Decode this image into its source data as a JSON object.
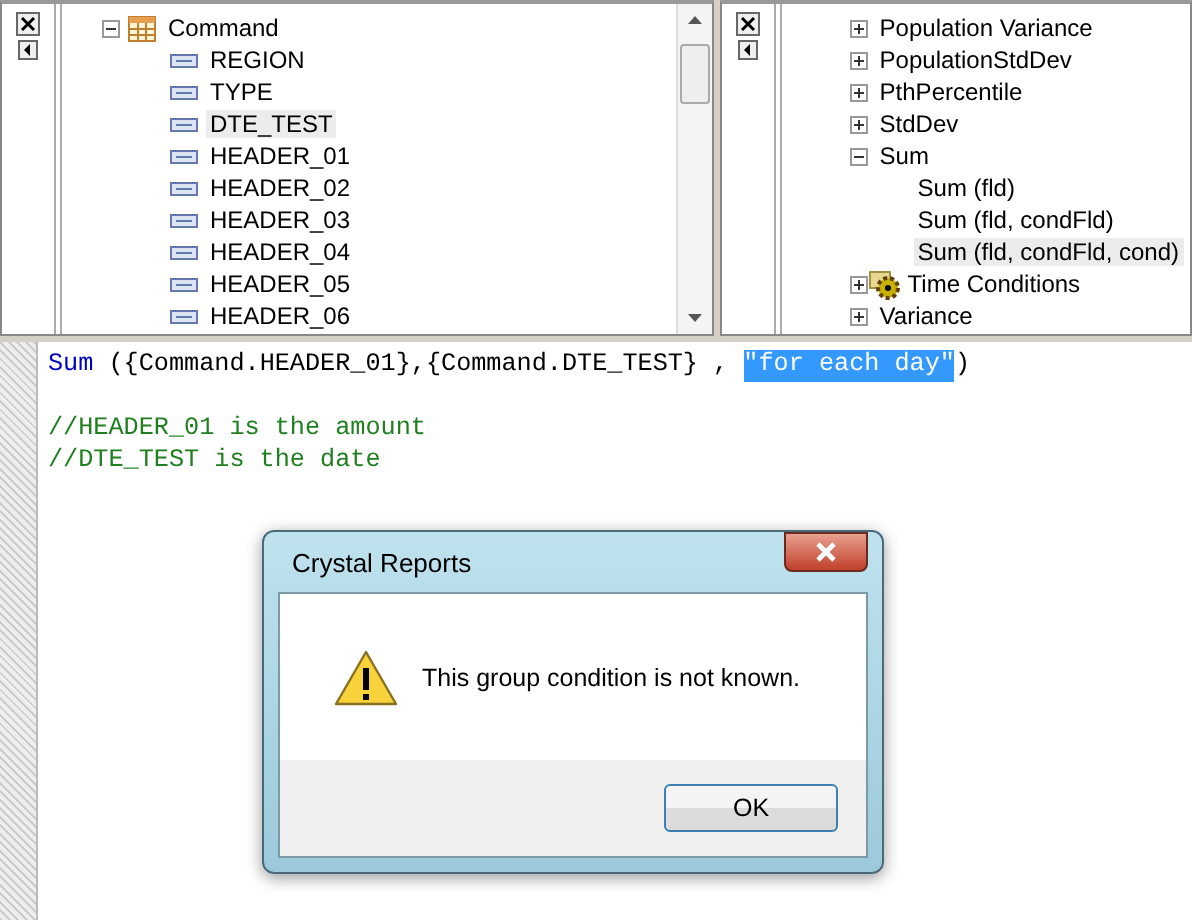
{
  "field_tree": {
    "table": {
      "label": "Command",
      "expanded": true,
      "children": [
        {
          "label": "REGION",
          "selected": false
        },
        {
          "label": "TYPE",
          "selected": false
        },
        {
          "label": "DTE_TEST",
          "selected": true
        },
        {
          "label": "HEADER_01",
          "selected": false
        },
        {
          "label": "HEADER_02",
          "selected": false
        },
        {
          "label": "HEADER_03",
          "selected": false
        },
        {
          "label": "HEADER_04",
          "selected": false
        },
        {
          "label": "HEADER_05",
          "selected": false
        },
        {
          "label": "HEADER_06",
          "selected": false
        }
      ]
    }
  },
  "function_tree": [
    {
      "label": "Population Variance",
      "expanded": false,
      "kind": "folder"
    },
    {
      "label": "PopulationStdDev",
      "expanded": false,
      "kind": "folder"
    },
    {
      "label": "PthPercentile",
      "expanded": false,
      "kind": "folder"
    },
    {
      "label": "StdDev",
      "expanded": false,
      "kind": "folder"
    },
    {
      "label": "Sum",
      "expanded": true,
      "kind": "folder",
      "children": [
        {
          "label": "Sum (fld)",
          "selected": false
        },
        {
          "label": "Sum (fld, condFld)",
          "selected": false
        },
        {
          "label": "Sum (fld, condFld, cond)",
          "selected": true
        }
      ]
    },
    {
      "label": "Time Conditions",
      "expanded": false,
      "kind": "gear"
    },
    {
      "label": "Variance",
      "expanded": false,
      "kind": "folder"
    }
  ],
  "code_lines": [
    {
      "kind": "code",
      "tokens": [
        {
          "text": "Sum",
          "kind": "keyword",
          "selected": false
        },
        {
          "text": " ({Command.HEADER_01},{Command.DTE_TEST} , ",
          "kind": "plain",
          "selected": false
        },
        {
          "text": "\"for each day\"",
          "kind": "string",
          "selected": true
        },
        {
          "text": ")",
          "kind": "plain",
          "selected": false
        }
      ]
    },
    {
      "kind": "blank"
    },
    {
      "kind": "code",
      "tokens": [
        {
          "text": "//HEADER_01 is the amount",
          "kind": "comment",
          "selected": false
        }
      ]
    },
    {
      "kind": "code",
      "tokens": [
        {
          "text": "//DTE_TEST is the date",
          "kind": "comment",
          "selected": false
        }
      ]
    }
  ],
  "dialog": {
    "title": "Crystal Reports",
    "message": "This group condition is not known.",
    "buttons": [
      "OK"
    ]
  }
}
